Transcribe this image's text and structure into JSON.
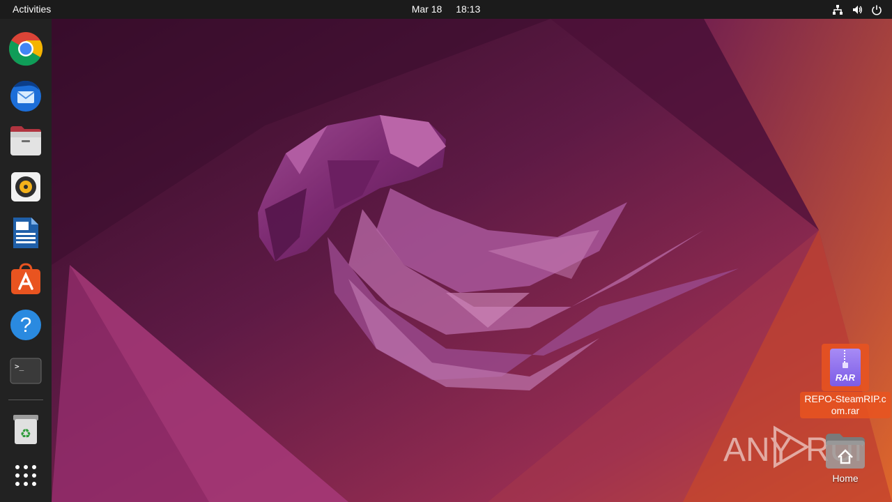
{
  "topbar": {
    "activities_label": "Activities",
    "date": "Mar 18",
    "time": "18:13",
    "tray_icons": [
      "network-icon",
      "volume-icon",
      "power-icon"
    ]
  },
  "dock": {
    "items": [
      {
        "name": "Google Chrome",
        "icon": "chrome-icon"
      },
      {
        "name": "Thunderbird Mail",
        "icon": "thunderbird-icon"
      },
      {
        "name": "Files",
        "icon": "files-icon"
      },
      {
        "name": "Rhythmbox",
        "icon": "rhythmbox-icon"
      },
      {
        "name": "LibreOffice Writer",
        "icon": "writer-icon"
      },
      {
        "name": "Ubuntu Software",
        "icon": "software-icon"
      },
      {
        "name": "Help",
        "icon": "help-icon"
      },
      {
        "name": "Terminal",
        "icon": "terminal-icon"
      },
      {
        "name": "Trash",
        "icon": "trash-icon"
      },
      {
        "name": "Show Applications",
        "icon": "app-grid-icon"
      }
    ]
  },
  "desktop": {
    "files": [
      {
        "label": "REPO-SteamRIP.com.rar",
        "icon": "rar-archive-icon",
        "icon_text": "RAR",
        "selected": true
      },
      {
        "label": "Home",
        "icon": "home-folder-icon",
        "selected": false
      }
    ]
  },
  "watermark": {
    "text_left": "ANY",
    "text_right": "RUN"
  },
  "colors": {
    "topbar": "#1b1b1b",
    "dock": "#222222",
    "selection": "#e95420",
    "wallpaper_dark": "#3a1230",
    "wallpaper_orange": "#d4552a"
  }
}
